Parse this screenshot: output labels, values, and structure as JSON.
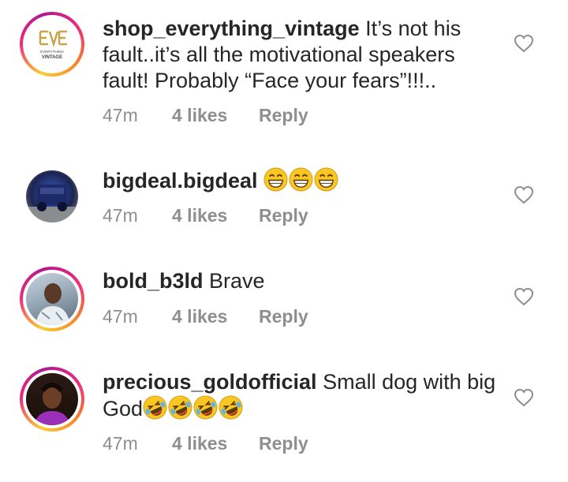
{
  "comments": [
    {
      "username": "shop_everything_vintage",
      "text": "It’s not his fault..it’s all the motivational speakers fault!  Probably “Face your fears”!!!..",
      "time": "47m",
      "likes": "4 likes",
      "reply": "Reply",
      "avatar_logo_letters": "EVE",
      "avatar_logo_line1": "EVERYTHING",
      "avatar_logo_line2": "VINTAGE"
    },
    {
      "username": "bigdeal.bigdeal",
      "text": "",
      "emojis": [
        "grinning-face",
        "grinning-face",
        "grinning-face"
      ],
      "time": "47m",
      "likes": "4 likes",
      "reply": "Reply"
    },
    {
      "username": "bold_b3ld",
      "text": "Brave",
      "time": "47m",
      "likes": "4 likes",
      "reply": "Reply"
    },
    {
      "username": "precious_goldofficial",
      "text": "Small dog with big God",
      "emojis": [
        "rolling-laughing-face",
        "rolling-laughing-face",
        "rolling-laughing-face",
        "rolling-laughing-face"
      ],
      "time": "47m",
      "likes": "4 likes",
      "reply": "Reply"
    }
  ],
  "colors": {
    "text": "#262626",
    "meta": "#8e8e8e",
    "logo_gold": "#c9a24a",
    "heart_stroke": "#8e8e8e",
    "emoji_yellow": "#f9c623"
  }
}
